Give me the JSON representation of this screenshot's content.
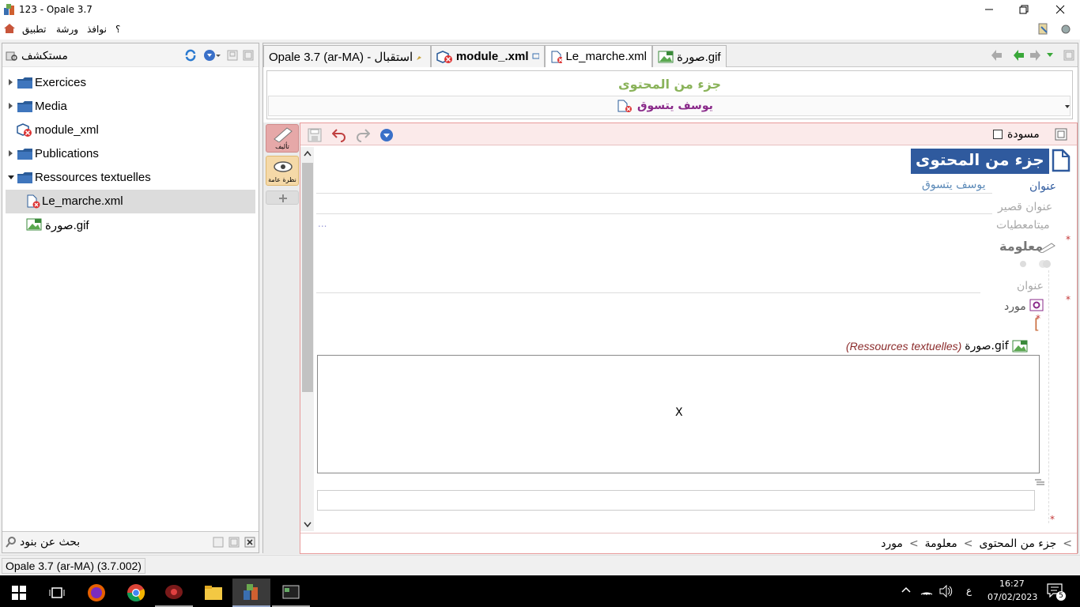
{
  "window": {
    "title": "123 - Opale 3.7"
  },
  "menubar": {
    "items": [
      "تطبيق",
      "ورشة",
      "نوافذ",
      "؟"
    ]
  },
  "explorer": {
    "title": "مستكشف",
    "tree": [
      {
        "label": "Exercices",
        "type": "folder",
        "expanded": false
      },
      {
        "label": "Media",
        "type": "folder",
        "expanded": false
      },
      {
        "label": "module_xml",
        "type": "file-error"
      },
      {
        "label": "Publications",
        "type": "folder",
        "expanded": false
      },
      {
        "label": "Ressources textuelles",
        "type": "folder",
        "expanded": true
      },
      {
        "label": "Le_marche.xml",
        "type": "file-error",
        "selected": true
      },
      {
        "label": "صورة.gif",
        "type": "image"
      }
    ],
    "search_label": "بحث عن بنود"
  },
  "tabs": [
    {
      "label": "Opale 3.7 (ar-MA) - استقبال",
      "active": false
    },
    {
      "label": "module_.xml",
      "active": false,
      "bold": true
    },
    {
      "label": "Le_marche.xml",
      "active": true
    },
    {
      "label": "صورة.gif",
      "active": false
    }
  ],
  "header": {
    "type_label": "جزء من المحتوى",
    "item_title": "يوسف يتسوق"
  },
  "toolbar": {
    "draft_label": "مسودة"
  },
  "side_tabs": {
    "author": "تأليف",
    "overview": "نظرة عامة"
  },
  "form": {
    "section_title": "جزء من المحتوى",
    "title_label": "عنوان",
    "title_value": "يوسف يتسوق",
    "short_title_label": "عنوان قصير",
    "metadata_label": "ميتامعطيات",
    "ellipsis": "...",
    "info_label": "معلومة",
    "info_title_label": "عنوان",
    "resource_label": "مورد",
    "resource_bracket": "[",
    "image_name": "صورة.gif",
    "image_folder": "(Ressources textuelles)",
    "image_placeholder": "X"
  },
  "breadcrumb": {
    "items": [
      "جزء من المحتوى",
      "معلومة",
      "مورد"
    ],
    "sep": ">"
  },
  "statusbar": {
    "text": "Opale 3.7 (ar-MA) (3.7.002)"
  },
  "taskbar": {
    "time": "16:27",
    "date": "07/02/2023",
    "lang": "ع",
    "notif_count": "5"
  },
  "colors": {
    "accent_blue": "#2f5a9e",
    "title_green": "#8ab35a",
    "error_red": "#c43535",
    "editor_border": "#e89a9a"
  }
}
